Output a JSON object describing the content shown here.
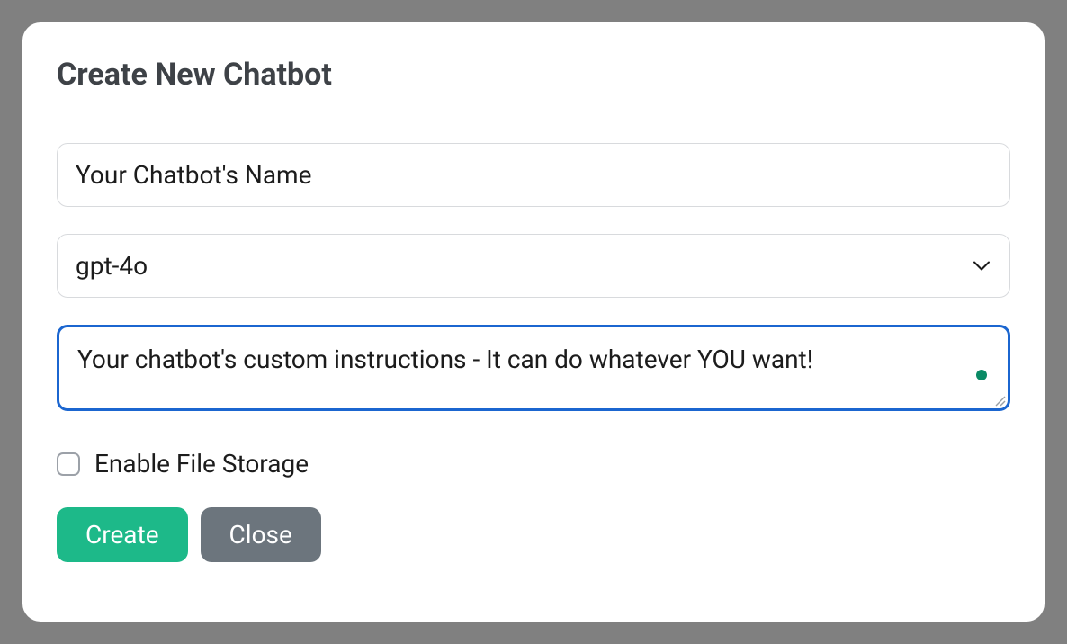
{
  "modal": {
    "title": "Create New Chatbot",
    "name_input": {
      "placeholder": "Your Chatbot's Name",
      "value": ""
    },
    "model_select": {
      "selected": "gpt-4o"
    },
    "instructions": {
      "placeholder": "Your chatbot's custom instructions - It can do whatever YOU want!",
      "value": ""
    },
    "file_storage": {
      "label": "Enable File Storage",
      "checked": false
    },
    "buttons": {
      "create": "Create",
      "close": "Close"
    },
    "status_color": "#0a8a65"
  }
}
